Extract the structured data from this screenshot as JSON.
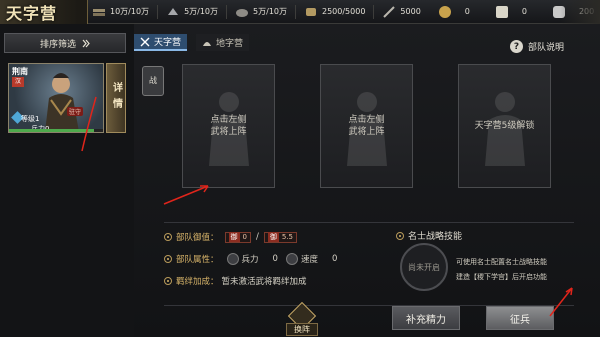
{
  "header": {
    "title": "天字营",
    "resources": [
      {
        "icon": "timber-icon",
        "value": "10万/10万"
      },
      {
        "icon": "iron-icon",
        "value": "5万/10万"
      },
      {
        "icon": "stone-icon",
        "value": "5万/10万"
      },
      {
        "icon": "grain-icon",
        "value": "2500/5000"
      },
      {
        "icon": "weapon-icon",
        "value": "5000"
      }
    ],
    "currencies": [
      {
        "icon": "copper-coin-icon",
        "value": "0"
      },
      {
        "icon": "jade-icon",
        "value": "0"
      },
      {
        "icon": "silver-icon",
        "value": "200"
      }
    ]
  },
  "sidebar": {
    "filter_label": "排序筛选",
    "hero": {
      "name": "荆南",
      "faction": "汉",
      "tag": "驻守",
      "level": "等级1",
      "troops": "兵力0",
      "troop_fill": 0.9
    },
    "details_label": "详情"
  },
  "tabs": [
    {
      "label": "天字营",
      "active": true
    },
    {
      "label": "地字营",
      "active": false
    }
  ],
  "unit_help_label": "部队说明",
  "battle_badge": "战",
  "slots": [
    {
      "text_line1": "点击左侧",
      "text_line2": "武将上阵"
    },
    {
      "text_line1": "点击左侧",
      "text_line2": "武将上阵"
    },
    {
      "text_line1": "天字营5级解锁",
      "text_line2": ""
    }
  ],
  "info": {
    "defense_label": "部队御值：",
    "defense_badge": "御",
    "defense_current": "0",
    "defense_sep": "/",
    "defense_max": "5.5",
    "attr_label": "部队属性：",
    "troops_label": "兵力",
    "troops_value": "0",
    "speed_label": "速度",
    "speed_value": "0",
    "bond_label": "羁绊加成：",
    "bond_text": "暂未激活武将羁绊加成",
    "skill_title": "名士战略技能",
    "skill_locked": "尚未开启",
    "skill_desc1": "可使用名士配置名士战略技能",
    "skill_desc2": "建造【稷下学宫】后开启功能"
  },
  "actions": {
    "swap_label": "换阵",
    "stamina_label": "补充精力",
    "dispatch_label": "征兵"
  },
  "colors": {
    "accent_gold": "#d9b56a",
    "tab_active": "#2e4d6f",
    "annotation_red": "#e0251b"
  }
}
